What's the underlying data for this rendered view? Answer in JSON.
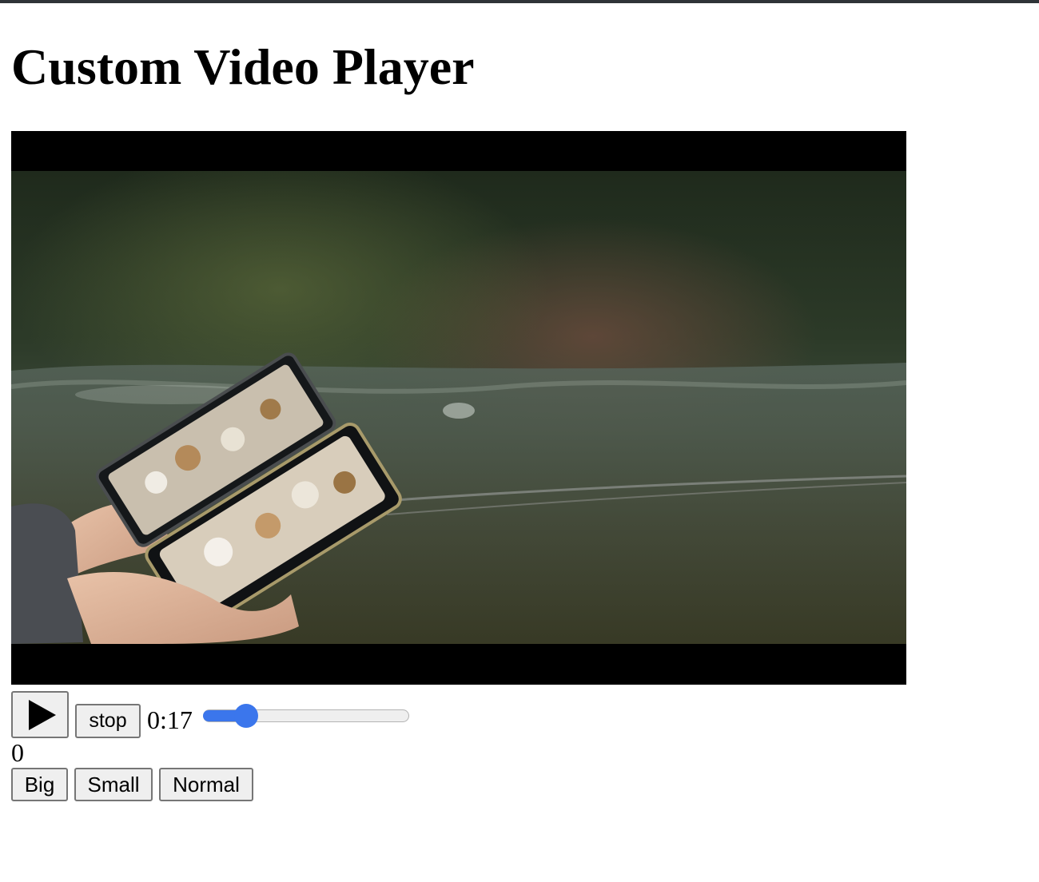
{
  "page": {
    "title": "Custom Video Player"
  },
  "player": {
    "play_icon": "play-icon",
    "stop_label": "stop",
    "current_time": "0:17",
    "progress_fraction": 0.21,
    "volume_value": "0"
  },
  "size_controls": {
    "big_label": "Big",
    "small_label": "Small",
    "normal_label": "Normal"
  },
  "colors": {
    "accent": "#3b76ec",
    "top_rule": "#2f3438",
    "video_background": "#000000"
  }
}
